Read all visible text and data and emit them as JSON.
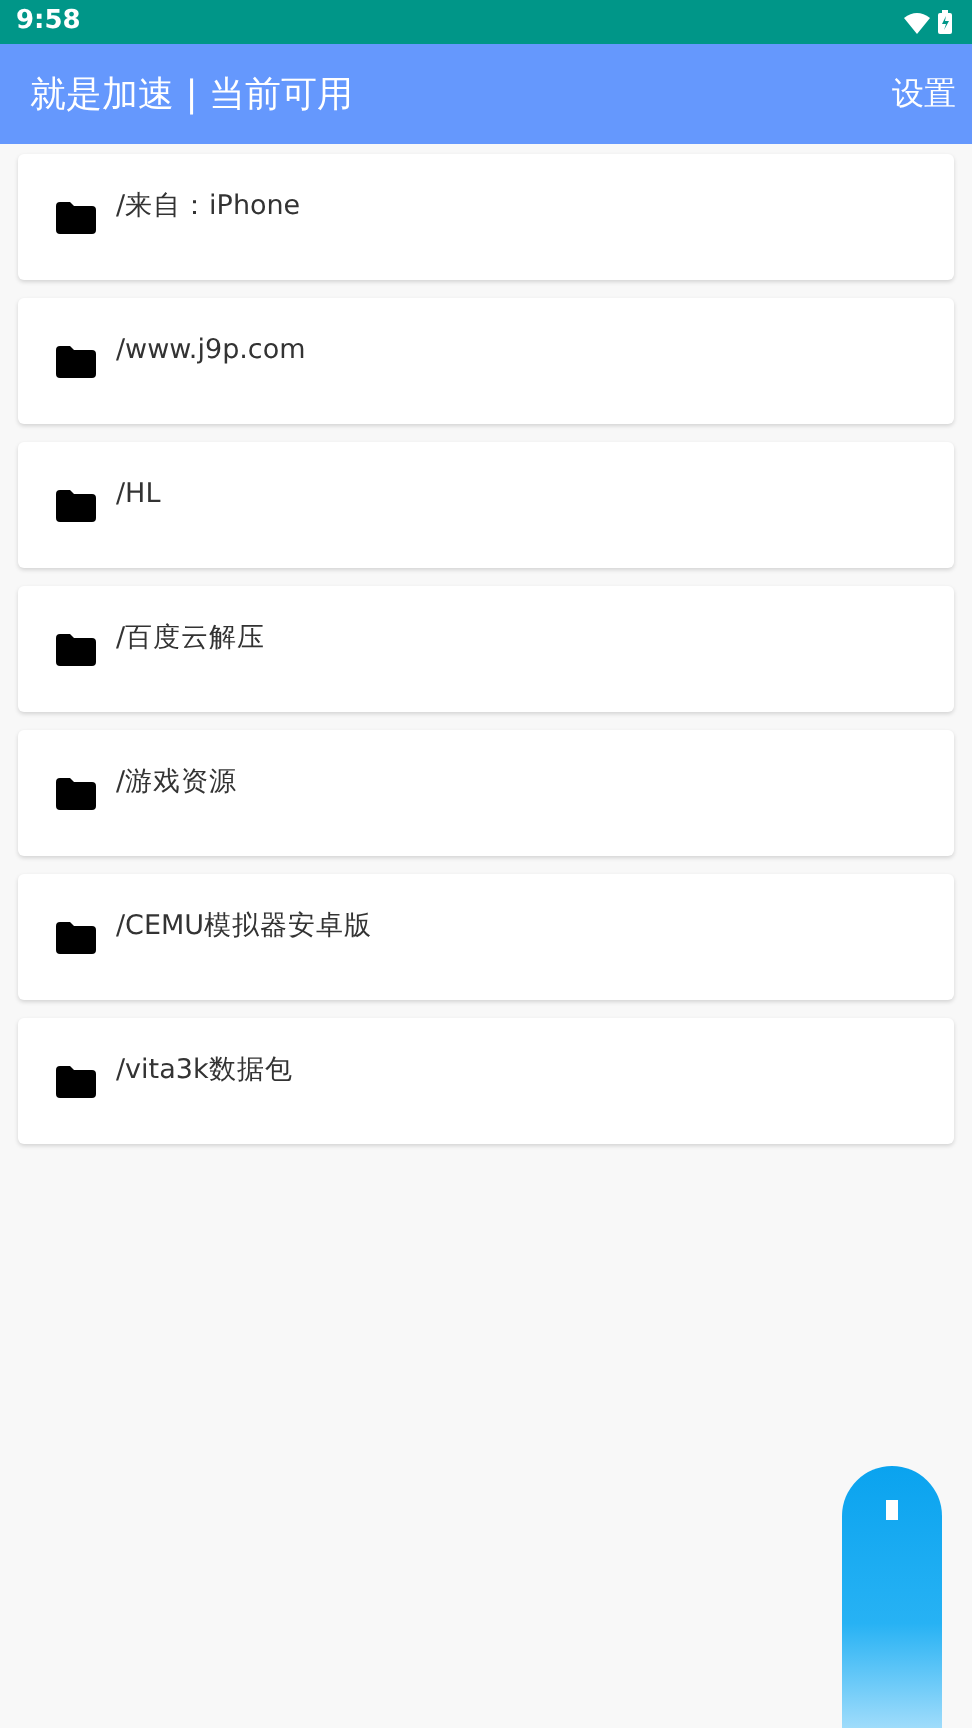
{
  "status_bar": {
    "time": "9:58"
  },
  "app_bar": {
    "title": "就是加速 | 当前可用",
    "action": "设置"
  },
  "folders": [
    {
      "path": "/来自：iPhone"
    },
    {
      "path": "/www.j9p.com"
    },
    {
      "path": "/HL"
    },
    {
      "path": "/百度云解压"
    },
    {
      "path": "/游戏资源"
    },
    {
      "path": "/CEMU模拟器安卓版"
    },
    {
      "path": "/vita3k数据包"
    }
  ]
}
